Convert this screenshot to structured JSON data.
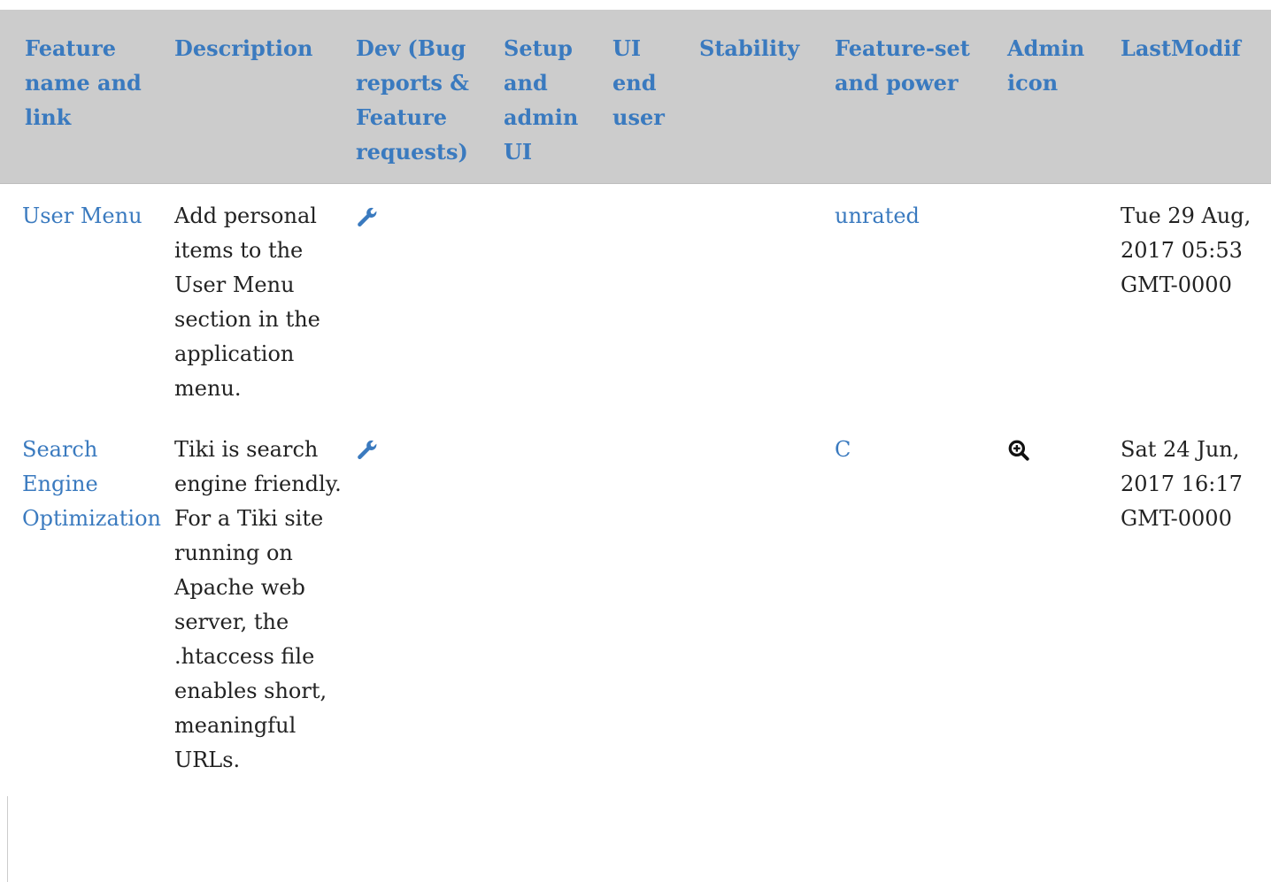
{
  "colors": {
    "link": "#3a7abf",
    "header_bg": "#cccccc",
    "text": "#222222"
  },
  "table": {
    "headers": [
      "Feature name and link",
      "Description",
      "Dev (Bug reports & Feature requests)",
      "Setup and admin UI",
      "UI end user",
      "Stability",
      "Feature-set and power",
      "Admin icon",
      "LastModif"
    ],
    "rows": [
      {
        "name": "User Menu",
        "description": "Add personal items to the User Menu section in the application menu.",
        "dev_icon": "wrench-icon",
        "rating": "unrated",
        "admin_icon": "",
        "last_modif": "Tue 29 Aug, 2017 05:53 GMT-0000"
      },
      {
        "name": "Search Engine Optimization",
        "description": "Tiki is search engine friendly. For a Tiki site running on Apache web server, the .htaccess file enables short, meaningful URLs.",
        "dev_icon": "wrench-icon",
        "rating": "C",
        "admin_icon": "zoom-in-icon",
        "last_modif": "Sat 24 Jun, 2017 16:17 GMT-0000"
      }
    ]
  }
}
